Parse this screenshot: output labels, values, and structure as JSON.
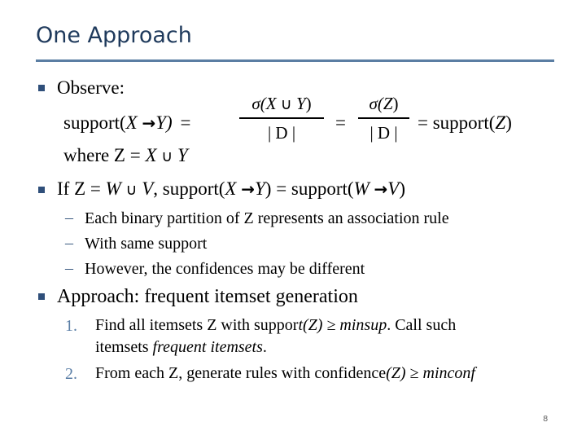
{
  "slide": {
    "title": "One Approach",
    "page_number": "8",
    "bullets": {
      "observe": {
        "label": "Observe:",
        "formula_lhs": "support(",
        "lhs_x": "X",
        "lhs_arrow": "→",
        "lhs_y": "Y)",
        "lhs_eq": "=",
        "frac1_num_sigma": "σ(",
        "frac1_num_x": "X",
        "frac1_num_cup": "∪",
        "frac1_num_y": "Y",
        "frac1_num_close": ")",
        "frac1_den": "| D |",
        "mid_eq": "=",
        "frac2_num_sigma": "σ(",
        "frac2_num_z": "Z",
        "frac2_num_close": ")",
        "frac2_den": "| D |",
        "rhs_eq": "= support(",
        "rhs_z": "Z",
        "rhs_close": ")",
        "where_prefix": "where Z = ",
        "where_x": "X",
        "where_cup": "∪",
        "where_y": "Y"
      },
      "partition": {
        "prefix": "If Z = ",
        "w": "W",
        "cup": "∪",
        "v": "V",
        "mid": ", support(",
        "x": "X",
        "arrow1": "→",
        "y": "Y",
        "eq": ") = support(",
        "w2": "W",
        "arrow2": "→",
        "v2": "V",
        "close": ")",
        "sub_items": [
          "Each binary partition of Z represents an association rule",
          "With same support",
          "However, the confidences may be different"
        ],
        "dash": "–"
      },
      "approach": {
        "label": "Approach: frequent itemset generation",
        "steps": [
          {
            "marker": "1.",
            "line1_a": "Find all itemsets Z with suppor",
            "line1_b": "t(Z) ≥ minsup",
            "line1_c": ". Call such",
            "line2_a": "itemsets ",
            "line2_b": "frequent itemsets",
            "line2_c": "."
          },
          {
            "marker": "2.",
            "line1_a": "From each Z, generate rules with confidence",
            "line1_b": "(Z) ≥ minconf"
          }
        ]
      }
    }
  }
}
